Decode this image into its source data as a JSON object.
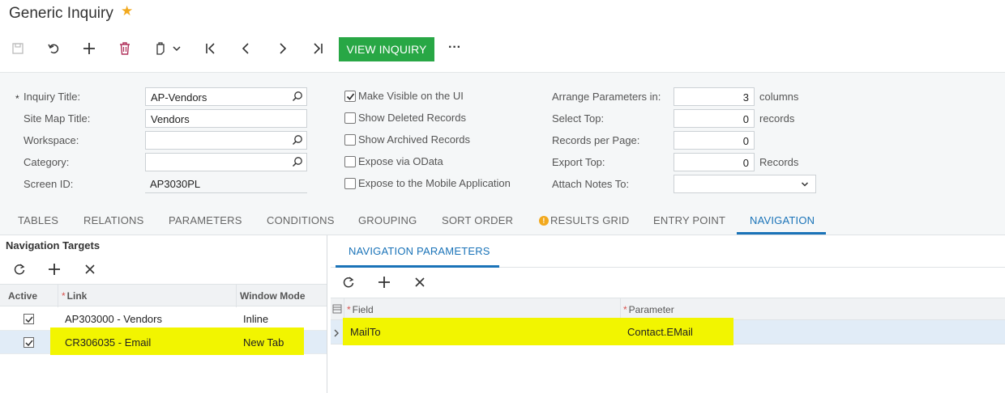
{
  "header": {
    "title": "Generic Inquiry"
  },
  "toolbar": {
    "view_inquiry_label": "VIEW INQUIRY",
    "more_label": "···"
  },
  "form": {
    "inquiry_title_label": "Inquiry Title:",
    "inquiry_title_value": "AP-Vendors",
    "site_map_title_label": "Site Map Title:",
    "site_map_title_value": "Vendors",
    "workspace_label": "Workspace:",
    "workspace_value": "",
    "category_label": "Category:",
    "category_value": "",
    "screen_id_label": "Screen ID:",
    "screen_id_value": "AP3030PL",
    "required_mark": "*",
    "checkboxes": [
      {
        "label": "Make Visible on the UI",
        "checked": true
      },
      {
        "label": "Show Deleted Records",
        "checked": false
      },
      {
        "label": "Show Archived Records",
        "checked": false
      },
      {
        "label": "Expose via OData",
        "checked": false
      },
      {
        "label": "Expose to the Mobile Application",
        "checked": false
      }
    ],
    "arrange_label": "Arrange Parameters in:",
    "arrange_value": "3",
    "arrange_suffix": "columns",
    "select_top_label": "Select Top:",
    "select_top_value": "0",
    "select_top_suffix": "records",
    "records_per_page_label": "Records per Page:",
    "records_per_page_value": "0",
    "export_top_label": "Export Top:",
    "export_top_value": "0",
    "export_top_suffix": "Records",
    "attach_notes_label": "Attach Notes To:",
    "attach_notes_value": ""
  },
  "tabs": [
    "TABLES",
    "RELATIONS",
    "PARAMETERS",
    "CONDITIONS",
    "GROUPING",
    "SORT ORDER",
    "RESULTS GRID",
    "ENTRY POINT",
    "NAVIGATION"
  ],
  "warning_mark": "!",
  "left_pane": {
    "title": "Navigation Targets",
    "columns": [
      "Active",
      "Link",
      "Window Mode"
    ],
    "rows": [
      {
        "active": true,
        "link": "AP303000 - Vendors",
        "mode": "Inline"
      },
      {
        "active": true,
        "link": "CR306035 - Email",
        "mode": "New Tab"
      }
    ]
  },
  "right_pane": {
    "tab": "NAVIGATION PARAMETERS",
    "columns": [
      "Field",
      "Parameter"
    ],
    "rows": [
      {
        "field": "MailTo",
        "parameter": "Contact.EMail"
      }
    ]
  },
  "colors": {
    "accent": "#1a73b8",
    "primary_button": "#28a745",
    "highlight": "#f2f500",
    "star": "#f2a91e"
  }
}
